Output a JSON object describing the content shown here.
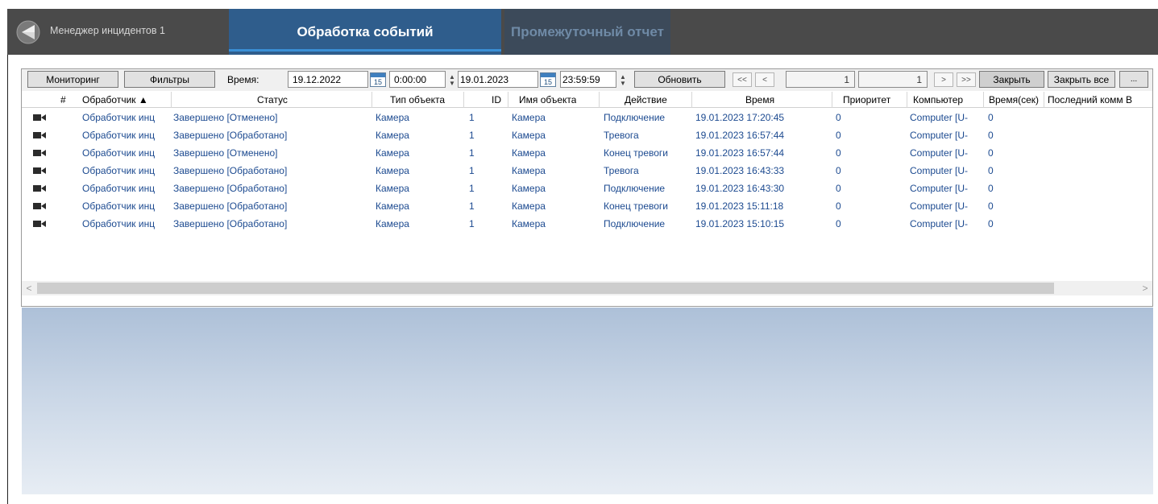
{
  "app": {
    "title": "Менеджер инцидентов 1",
    "logo_icon": "back-triangle-icon"
  },
  "tabs": [
    {
      "label": "Обработка событий",
      "active": true
    },
    {
      "label": "Промежуточный отчет",
      "active": false
    }
  ],
  "toolbar": {
    "monitoring": "Мониторинг",
    "filters": "Фильтры",
    "time_label": "Время:",
    "date_from": "19.12.2022",
    "time_from": "0:00:00",
    "date_to": "19.01.2023",
    "time_to": "23:59:59",
    "calendar_day": "15",
    "refresh": "Обновить",
    "first": "<<",
    "prev": "<",
    "page_current": "1",
    "page_total": "1",
    "next": ">",
    "last": ">>",
    "close": "Закрыть",
    "close_all": "Закрыть все",
    "more": "..."
  },
  "grid": {
    "columns": [
      "#",
      "Обработчик ▲",
      "Статус",
      "Тип объекта",
      "ID",
      "Имя объекта",
      "Действие",
      "Время",
      "Приоритет",
      "Компьютер",
      "Время(сек)",
      "Последний комм В"
    ],
    "rows": [
      {
        "handler": "Обработчик инц",
        "status": "Завершено [Отменено]",
        "obj_type": "Камера",
        "id": "1",
        "obj_name": "Камера",
        "action": "Подключение",
        "time": "19.01.2023 17:20:45",
        "priority": "0",
        "computer": "Computer [U-",
        "sec": "0"
      },
      {
        "handler": "Обработчик инц",
        "status": "Завершено [Обработано]",
        "obj_type": "Камера",
        "id": "1",
        "obj_name": "Камера",
        "action": "Тревога",
        "time": "19.01.2023 16:57:44",
        "priority": "0",
        "computer": "Computer [U-",
        "sec": "0"
      },
      {
        "handler": "Обработчик инц",
        "status": "Завершено [Отменено]",
        "obj_type": "Камера",
        "id": "1",
        "obj_name": "Камера",
        "action": "Конец тревоги",
        "time": "19.01.2023 16:57:44",
        "priority": "0",
        "computer": "Computer [U-",
        "sec": "0"
      },
      {
        "handler": "Обработчик инц",
        "status": "Завершено [Обработано]",
        "obj_type": "Камера",
        "id": "1",
        "obj_name": "Камера",
        "action": "Тревога",
        "time": "19.01.2023 16:43:33",
        "priority": "0",
        "computer": "Computer [U-",
        "sec": "0"
      },
      {
        "handler": "Обработчик инц",
        "status": "Завершено [Обработано]",
        "obj_type": "Камера",
        "id": "1",
        "obj_name": "Камера",
        "action": "Подключение",
        "time": "19.01.2023 16:43:30",
        "priority": "0",
        "computer": "Computer [U-",
        "sec": "0"
      },
      {
        "handler": "Обработчик инц",
        "status": "Завершено [Обработано]",
        "obj_type": "Камера",
        "id": "1",
        "obj_name": "Камера",
        "action": "Конец тревоги",
        "time": "19.01.2023 15:11:18",
        "priority": "0",
        "computer": "Computer [U-",
        "sec": "0"
      },
      {
        "handler": "Обработчик инц",
        "status": "Завершено [Обработано]",
        "obj_type": "Камера",
        "id": "1",
        "obj_name": "Камера",
        "action": "Подключение",
        "time": "19.01.2023 15:10:15",
        "priority": "0",
        "computer": "Computer [U-",
        "sec": "0"
      }
    ],
    "row_icon": "video-camera-icon"
  },
  "scrollbar": {
    "left": "<",
    "right": ">"
  },
  "colors": {
    "topbar": "#4a4a4a",
    "active_tab": "#2f5d8c",
    "link_text": "#1c4a90"
  }
}
